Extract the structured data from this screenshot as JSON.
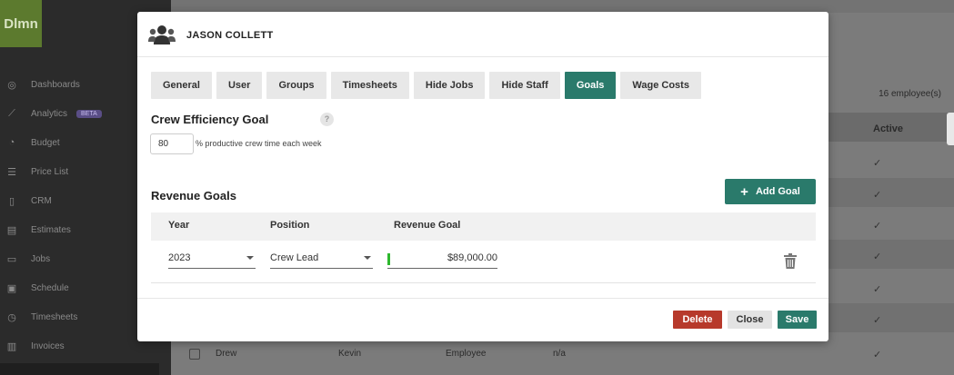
{
  "app": {
    "logo_text": "Dlmn"
  },
  "sidebar": {
    "items": [
      {
        "label": "Dashboards",
        "icon": "palette-icon"
      },
      {
        "label": "Analytics",
        "icon": "chart-line-icon",
        "badge": "BETA"
      },
      {
        "label": "Budget",
        "icon": "pie-chart-icon"
      },
      {
        "label": "Price List",
        "icon": "list-icon"
      },
      {
        "label": "CRM",
        "icon": "contact-card-icon"
      },
      {
        "label": "Estimates",
        "icon": "calculator-icon"
      },
      {
        "label": "Jobs",
        "icon": "jobs-icon"
      },
      {
        "label": "Schedule",
        "icon": "calendar-icon"
      },
      {
        "label": "Timesheets",
        "icon": "clock-icon"
      },
      {
        "label": "Invoices",
        "icon": "invoice-icon"
      }
    ]
  },
  "background": {
    "employee_count": "16  employee(s)",
    "active_header": "Active",
    "last_row": {
      "name": "Drew",
      "first": "Kevin",
      "role": "Employee",
      "extra": "n/a"
    }
  },
  "modal": {
    "title": "JASON COLLETT",
    "tabs": [
      "General",
      "User",
      "Groups",
      "Timesheets",
      "Hide Jobs",
      "Hide Staff",
      "Goals",
      "Wage Costs"
    ],
    "active_tab": "Goals",
    "crew_efficiency": {
      "title": "Crew Efficiency Goal",
      "help": "?",
      "value": "80",
      "suffix": "% productive crew time each week"
    },
    "revenue_goals": {
      "title": "Revenue Goals",
      "add_button": "Add Goal",
      "columns": [
        "Year",
        "Position",
        "Revenue Goal"
      ],
      "rows": [
        {
          "year": "2023",
          "position": "Crew Lead",
          "revenue": "$89,000.00"
        }
      ]
    },
    "footer": {
      "delete": "Delete",
      "close": "Close",
      "save": "Save"
    }
  },
  "colors": {
    "accent": "#2a7a6b",
    "danger": "#b7392b",
    "sidebar": "#2b2b2b"
  }
}
